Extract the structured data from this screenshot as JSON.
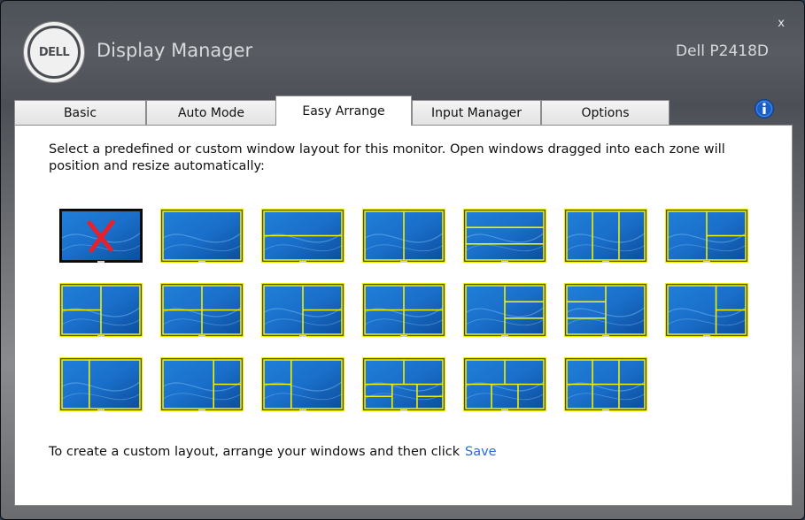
{
  "window": {
    "app_title": "Display Manager",
    "monitor_name": "Dell P2418D",
    "close_label": "x",
    "logo_text": "DELL"
  },
  "tabs": [
    {
      "label": "Basic",
      "active": false
    },
    {
      "label": "Auto Mode",
      "active": false
    },
    {
      "label": "Easy Arrange",
      "active": true
    },
    {
      "label": "Input Manager",
      "active": false
    },
    {
      "label": "Options",
      "active": false
    }
  ],
  "panel": {
    "description": "Select a predefined or custom window layout for this monitor.  Open windows dragged into each zone will position and resize automatically:",
    "footer_text": "To create a custom layout, arrange your windows and then click",
    "save_label": "Save"
  },
  "layouts": {
    "count": 20,
    "selected_index": 0,
    "names": [
      "no-layout",
      "full",
      "two-rows",
      "two-columns",
      "three-rows",
      "three-columns",
      "left-plus-right-split",
      "left-split-plus-right",
      "two-by-two-wide",
      "left-plus-two-rows",
      "two-by-two",
      "left-plus-three-rows",
      "three-rows-plus-right",
      "wide-left-plus-right-split",
      "narrow-left-plus-right",
      "wide-left-plus-narrow-right",
      "left-split-plus-right-wide",
      "top-plus-bottom-quad",
      "top-plus-bottom-triple",
      "two-by-three"
    ]
  },
  "colors": {
    "zone_line": "#f0f000",
    "thumb_border": "#e8e800",
    "selected_border": "#000000",
    "selected_mark": "#e8202a",
    "link": "#2a6ad8",
    "info_icon": "#1a5fc6"
  },
  "icons": {
    "info": "info-icon",
    "close": "close-icon",
    "no_layout": "red-x-icon"
  }
}
